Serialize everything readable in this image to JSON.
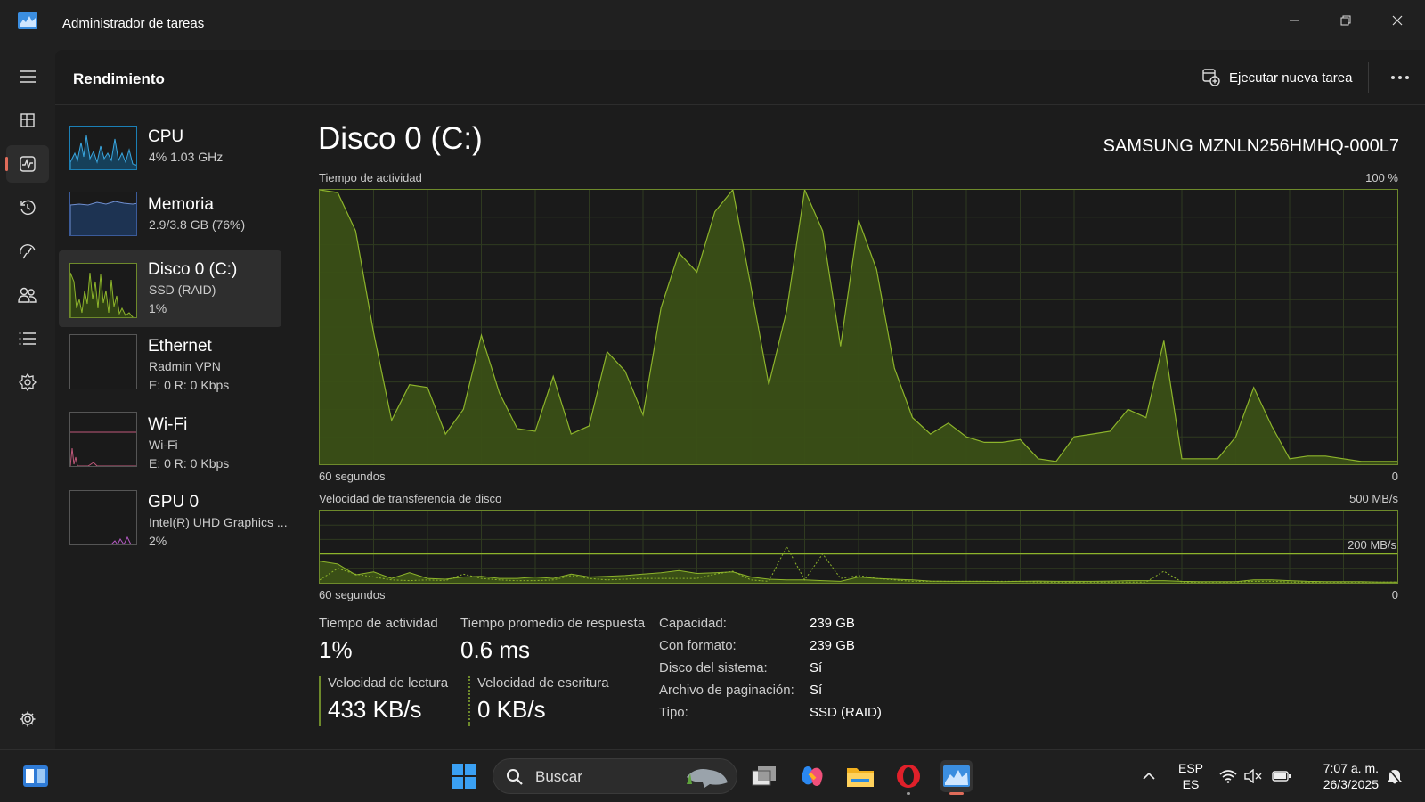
{
  "window": {
    "title": "Administrador de tareas"
  },
  "header": {
    "title": "Rendimiento",
    "run_task_label": "Ejecutar nueva tarea"
  },
  "nav": [
    {
      "name": "menu",
      "icon": "hamburger-icon"
    },
    {
      "name": "processes",
      "icon": "processes-icon"
    },
    {
      "name": "performance",
      "icon": "performance-icon"
    },
    {
      "name": "app-history",
      "icon": "history-icon"
    },
    {
      "name": "startup-apps",
      "icon": "startup-icon"
    },
    {
      "name": "users",
      "icon": "users-icon"
    },
    {
      "name": "details",
      "icon": "details-icon"
    },
    {
      "name": "services",
      "icon": "services-icon"
    },
    {
      "name": "settings",
      "icon": "gear-icon"
    }
  ],
  "side_items": [
    {
      "name": "CPU",
      "line1": "4%  1.03 GHz",
      "line2": ""
    },
    {
      "name": "Memoria",
      "line1": "2.9/3.8 GB (76%)",
      "line2": ""
    },
    {
      "name": "Disco 0 (C:)",
      "line1": "SSD (RAID)",
      "line2": "1%"
    },
    {
      "name": "Ethernet",
      "line1": "Radmin VPN",
      "line2": "E: 0  R: 0 Kbps"
    },
    {
      "name": "Wi-Fi",
      "line1": "Wi-Fi",
      "line2": "E: 0  R: 0 Kbps"
    },
    {
      "name": "GPU 0",
      "line1": "Intel(R) UHD Graphics ...",
      "line2": "2%"
    }
  ],
  "main": {
    "title": "Disco 0 (C:)",
    "model": "SAMSUNG MZNLN256HMHQ-000L7",
    "chart1_label": "Tiempo de actividad",
    "chart1_max": "100 %",
    "chart1_xleft": "60 segundos",
    "chart1_xright": "0",
    "chart2_label": "Velocidad de transferencia de disco",
    "chart2_max": "500 MB/s",
    "chart2_line": "200 MB/s",
    "chart2_xleft": "60 segundos",
    "chart2_xright": "0"
  },
  "stats": {
    "active_label": "Tiempo de actividad",
    "active_value": "1%",
    "response_label": "Tiempo promedio de respuesta",
    "response_value": "0.6 ms",
    "read_label": "Velocidad de lectura",
    "read_value": "433 KB/s",
    "write_label": "Velocidad de escritura",
    "write_value": "0 KB/s"
  },
  "props": [
    {
      "label": "Capacidad:",
      "value": "239 GB"
    },
    {
      "label": "Con formato:",
      "value": "239 GB"
    },
    {
      "label": "Disco del sistema:",
      "value": "Sí"
    },
    {
      "label": "Archivo de paginación:",
      "value": "Sí"
    },
    {
      "label": "Tipo:",
      "value": "SSD (RAID)"
    }
  ],
  "taskbar": {
    "search_placeholder": "Buscar",
    "lang_top": "ESP",
    "lang_bottom": "ES",
    "time": "7:07 a. m.",
    "date": "26/3/2025"
  },
  "chart_data": [
    {
      "type": "area",
      "title": "Tiempo de actividad",
      "xlabel": "60 segundos",
      "ylabel": "",
      "xlim": [
        60,
        0
      ],
      "ylim": [
        0,
        100
      ],
      "x": [
        60,
        59,
        58,
        57,
        56,
        55,
        54,
        53,
        52,
        51,
        50,
        49,
        48,
        47,
        46,
        45,
        44,
        43,
        42,
        41,
        40,
        39,
        38,
        37,
        36,
        35,
        34,
        33,
        32,
        31,
        30,
        29,
        28,
        27,
        26,
        25,
        24,
        23,
        22,
        21,
        20,
        19,
        18,
        17,
        16,
        15,
        14,
        13,
        12,
        11,
        10,
        9,
        8,
        7,
        6,
        5,
        4,
        3,
        2,
        1,
        0
      ],
      "series": [
        {
          "values": [
            100,
            99,
            85,
            48,
            16,
            29,
            28,
            11,
            20,
            47,
            26,
            13,
            12,
            32,
            11,
            14,
            41,
            34,
            18,
            57,
            77,
            70,
            92,
            100,
            65,
            29,
            56,
            100,
            85,
            43,
            89,
            71,
            35,
            17,
            11,
            15,
            10,
            8,
            8,
            9,
            2,
            1,
            10,
            11,
            12,
            20,
            17,
            45,
            2,
            2,
            2,
            10,
            28,
            14,
            2,
            3,
            3,
            2,
            1,
            1,
            1
          ],
          "color": "#8db42b"
        }
      ]
    },
    {
      "type": "line",
      "title": "Velocidad de transferencia de disco",
      "xlabel": "60 segundos",
      "ylabel": "",
      "xlim": [
        60,
        0
      ],
      "ylim": [
        0,
        500
      ],
      "x": [
        60,
        59,
        58,
        57,
        56,
        55,
        54,
        53,
        52,
        51,
        50,
        49,
        48,
        47,
        46,
        45,
        44,
        43,
        42,
        41,
        40,
        39,
        38,
        37,
        36,
        35,
        34,
        33,
        32,
        31,
        30,
        29,
        28,
        27,
        26,
        25,
        24,
        23,
        22,
        21,
        20,
        19,
        18,
        17,
        16,
        15,
        14,
        13,
        12,
        11,
        10,
        9,
        8,
        7,
        6,
        5,
        4,
        3,
        2,
        1,
        0
      ],
      "series": [
        {
          "values": [
            150,
            130,
            55,
            75,
            30,
            70,
            30,
            25,
            40,
            45,
            30,
            30,
            40,
            30,
            60,
            40,
            45,
            50,
            60,
            70,
            85,
            65,
            70,
            75,
            40,
            25,
            20,
            20,
            15,
            10,
            40,
            30,
            25,
            20,
            12,
            10,
            10,
            10,
            8,
            10,
            12,
            10,
            10,
            10,
            12,
            15,
            15,
            15,
            10,
            8,
            8,
            8,
            20,
            20,
            15,
            10,
            8,
            8,
            8,
            5,
            5
          ],
          "color": "#8db42b"
        },
        {
          "values": [
            20,
            100,
            60,
            40,
            20,
            15,
            20,
            15,
            60,
            30,
            20,
            15,
            15,
            20,
            50,
            30,
            20,
            25,
            30,
            30,
            30,
            30,
            60,
            80,
            20,
            10,
            250,
            20,
            200,
            30,
            50,
            30,
            20,
            10,
            10,
            10,
            10,
            10,
            10,
            10,
            5,
            5,
            5,
            5,
            5,
            5,
            5,
            80,
            5,
            5,
            5,
            5,
            10,
            10,
            5,
            5,
            5,
            5,
            5,
            5,
            5
          ],
          "color": "#8db42b",
          "dashed": true
        }
      ]
    }
  ]
}
